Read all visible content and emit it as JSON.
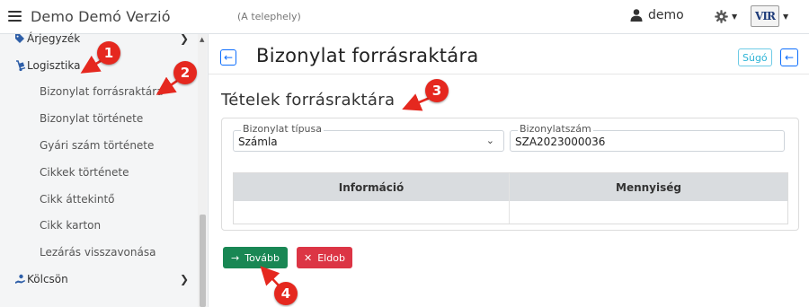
{
  "app": {
    "title": "Demo Demó Verzió",
    "subtitle": "(A telephely)"
  },
  "user": {
    "name": "demo"
  },
  "logo": {
    "text": "VIR"
  },
  "sidebar": {
    "items": [
      {
        "label": "Árjegyzék",
        "icon": "tag-icon"
      },
      {
        "label": "Logisztika",
        "icon": "dolly-icon"
      },
      {
        "label": "Kölcsön",
        "icon": "hand-icon"
      }
    ],
    "subitems": [
      "Bizonylat forrásraktára",
      "Bizonylat története",
      "Gyári szám története",
      "Cikkek története",
      "Cikk áttekintő",
      "Cikk karton",
      "Lezárás visszavonása"
    ]
  },
  "page": {
    "title": "Bizonylat forrásraktára",
    "help_label": "Súgó",
    "section_title": "Tételek forrásraktára"
  },
  "form": {
    "doc_type": {
      "label": "Bizonylat típusa",
      "value": "Számla"
    },
    "doc_number": {
      "label": "Bizonylatszám",
      "value": "SZA2023000036"
    }
  },
  "table": {
    "headers": [
      "Információ",
      "Mennyiség"
    ]
  },
  "buttons": {
    "next": "Tovább",
    "discard": "Eldob"
  },
  "markers": [
    "1",
    "2",
    "3",
    "4"
  ],
  "colors": {
    "primary": "#0d6efd",
    "success": "#198754",
    "danger": "#dc3545",
    "marker": "#e5281f"
  }
}
